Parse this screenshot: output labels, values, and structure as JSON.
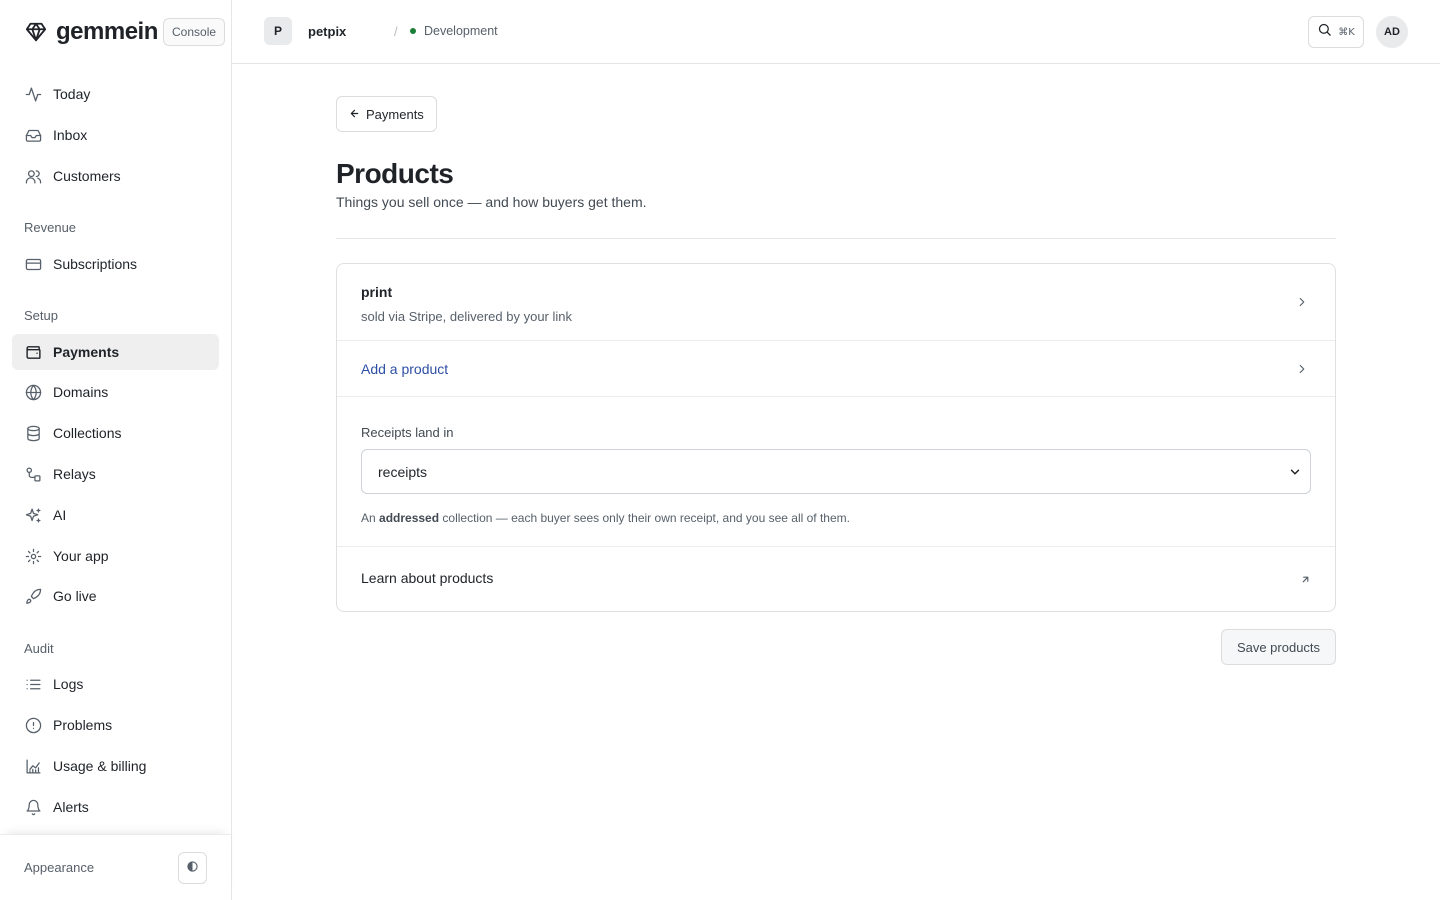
{
  "brand": {
    "name": "gemmein",
    "badge": "Console",
    "logo_icon": "diamond-icon"
  },
  "sidebar": {
    "top_items": [
      {
        "label": "Today",
        "icon": "activity-icon"
      },
      {
        "label": "Inbox",
        "icon": "inbox-icon"
      },
      {
        "label": "Customers",
        "icon": "users-icon"
      }
    ],
    "sections": [
      {
        "label": "Revenue",
        "items": [
          {
            "label": "Subscriptions",
            "icon": "credit-card-icon"
          }
        ]
      },
      {
        "label": "Setup",
        "items": [
          {
            "label": "Payments",
            "icon": "wallet-icon",
            "active": true
          },
          {
            "label": "Domains",
            "icon": "globe-icon"
          },
          {
            "label": "Collections",
            "icon": "database-icon"
          },
          {
            "label": "Relays",
            "icon": "relay-icon"
          },
          {
            "label": "AI",
            "icon": "sparkles-icon"
          },
          {
            "label": "Your app",
            "icon": "gear-icon"
          },
          {
            "label": "Go live",
            "icon": "rocket-icon"
          }
        ]
      },
      {
        "label": "Audit",
        "items": [
          {
            "label": "Logs",
            "icon": "list-icon"
          },
          {
            "label": "Problems",
            "icon": "alert-circle-icon"
          },
          {
            "label": "Usage & billing",
            "icon": "chart-icon"
          },
          {
            "label": "Alerts",
            "icon": "bell-icon"
          }
        ]
      }
    ],
    "footer": {
      "appearance_label": "Appearance",
      "theme_icon": "half-circle-icon"
    }
  },
  "header": {
    "project_initial": "P",
    "project_name": "petpix",
    "separator": "/",
    "environment": "Development",
    "environment_color": "#1a7f37",
    "search_shortcut": "⌘K",
    "user_initials": "AD"
  },
  "main": {
    "back_label": "Payments",
    "title": "Products",
    "subtitle": "Things you sell once — and how buyers get them.",
    "product": {
      "name": "print",
      "description": "sold via Stripe, delivered by your link"
    },
    "add_product_label": "Add a product",
    "receipts": {
      "label": "Receipts land in",
      "selected": "receipts",
      "help_prefix": "An",
      "help_bold": "addressed",
      "help_suffix": "collection — each buyer sees only their own receipt, and you see all of them."
    },
    "learn_label": "Learn about products",
    "save_label": "Save products"
  },
  "colors": {
    "accent_link": "#2d4fa3",
    "active_nav_bg": "#efefef"
  }
}
